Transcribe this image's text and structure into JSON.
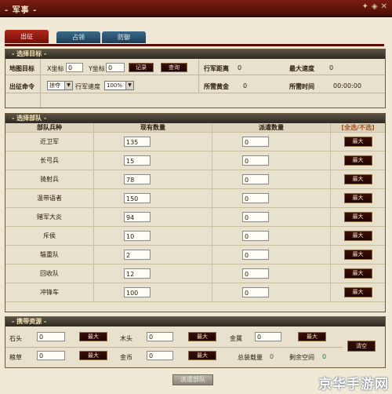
{
  "window": {
    "title": "- 军事 -"
  },
  "tabs": [
    {
      "label": "出征"
    },
    {
      "label": "占领"
    },
    {
      "label": "防御"
    }
  ],
  "target": {
    "heading": "- 选择目标 -",
    "map_target_label": "地图目标",
    "x_label": "X坐标",
    "x_value": "0",
    "y_label": "Y坐标",
    "y_value": "0",
    "record_button": "记录",
    "query_button": "查询",
    "distance_label": "行军距离",
    "distance_value": "0",
    "max_speed_label": "最大速度",
    "max_speed_value": "0",
    "command_label": "出征命令",
    "command_value": "掠夺",
    "march_speed_label": "行军速度",
    "march_speed_value": "100%",
    "gold_label": "所需黄金",
    "gold_value": "0",
    "time_label": "所需时间",
    "time_value": "00:00:00"
  },
  "troops": {
    "heading": "- 选择部队 -",
    "col_type": "部队兵种",
    "col_have": "现有数量",
    "col_send": "派遣数量",
    "select_all": "[全选/不选]",
    "max_label": "最大",
    "rows": [
      {
        "name": "近卫军",
        "have": "135",
        "send": "0"
      },
      {
        "name": "长弓兵",
        "have": "15",
        "send": "0"
      },
      {
        "name": "骑射兵",
        "have": "78",
        "send": "0"
      },
      {
        "name": "温带语者",
        "have": "150",
        "send": "0"
      },
      {
        "name": "赌军大炎",
        "have": "94",
        "send": "0"
      },
      {
        "name": "斥侯",
        "have": "10",
        "send": "0"
      },
      {
        "name": "辎重队",
        "have": "2",
        "send": "0"
      },
      {
        "name": "回收队",
        "have": "12",
        "send": "0"
      },
      {
        "name": "冲锋车",
        "have": "100",
        "send": "0"
      }
    ]
  },
  "resources": {
    "heading": "- 携带资源 -",
    "stone_label": "石头",
    "stone_value": "0",
    "wood_label": "木头",
    "wood_value": "0",
    "metal_label": "金属",
    "metal_value": "0",
    "food_label": "粮草",
    "food_value": "0",
    "gold_label": "金币",
    "gold_value": "0",
    "total_label": "总装载量",
    "total_value": "0",
    "remaining_label": "剩余空间",
    "remaining_value": "0",
    "max_label": "最大",
    "clear_button": "清空"
  },
  "submit_button": "派遣部队",
  "watermark": "京华手游网",
  "colors": {
    "titlebar": "#5e1409",
    "tab_active": "#9a1f14",
    "tab_inactive": "#2b5370",
    "select_all": "#b44a10"
  }
}
